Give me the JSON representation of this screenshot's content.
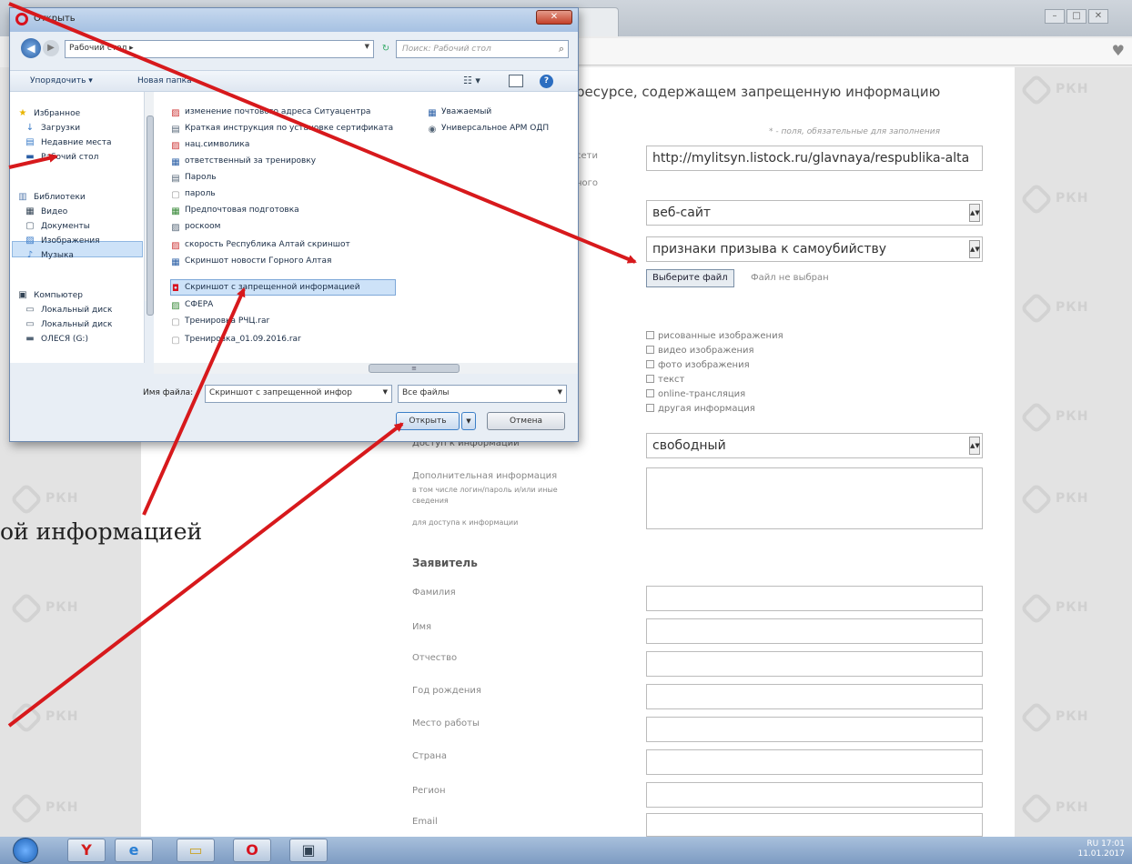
{
  "browser": {
    "window_controls": [
      "–",
      "□",
      "✕"
    ]
  },
  "watermark": {
    "text": "РКН"
  },
  "page": {
    "heading": "ресурсе, содержащем запрещенную информацию",
    "required_note": "* - поля, обязательные для заполнения",
    "label_fragment_1": "сети",
    "label_fragment_2": "ного",
    "url_value": "http://mylitsyn.listock.ru/glavnaya/respublika-alta",
    "resource_type": "веб-сайт",
    "info_type": "признаки призыва к самоубийству",
    "choose_file_label": "Выберите файл",
    "no_file_text": "Файл не выбран",
    "content_types": [
      "рисованные изображения",
      "видео изображения",
      "фото изображения",
      "текст",
      "online-трансляция",
      "другая информация"
    ],
    "access_label": "Доступ к информации",
    "access_value": "свободный",
    "extra_label": "Дополнительная информация",
    "extra_sub1": "в том числе логин/пароль и/или иные",
    "extra_sub2": "сведения",
    "extra_sub3": "для доступа к информации",
    "applicant_section": "Заявитель",
    "applicant_fields": [
      "Фамилия",
      "Имя",
      "Отчество",
      "Год рождения",
      "Место работы",
      "Страна",
      "Регион",
      "Email"
    ]
  },
  "caption": "ой информацией",
  "dialog": {
    "title": "Открыть",
    "path": "Рабочий стол ▸",
    "search_placeholder": "Поиск: Рабочий стол",
    "toolbar_organize": "Упорядочить ▾",
    "toolbar_new_folder": "Новая папка",
    "nav_items": [
      {
        "label": "Избранное",
        "icon": "star-icon"
      },
      {
        "label": "Загрузки",
        "icon": "downloads-icon"
      },
      {
        "label": "Недавние места",
        "icon": "recent-places-icon"
      },
      {
        "label": "Рабочий стол",
        "icon": "desktop-icon"
      },
      {
        "label": "Библиотеки",
        "icon": "libraries-icon"
      },
      {
        "label": "Видео",
        "icon": "video-icon"
      },
      {
        "label": "Документы",
        "icon": "documents-icon"
      },
      {
        "label": "Изображения",
        "icon": "images-icon"
      },
      {
        "label": "Музыка",
        "icon": "music-icon"
      },
      {
        "label": "Компьютер",
        "icon": "computer-icon"
      },
      {
        "label": "Локальный диск",
        "icon": "disk-icon"
      },
      {
        "label": "Локальный диск",
        "icon": "disk-icon"
      },
      {
        "label": "ОЛЕСЯ (G:)",
        "icon": "usb-drive-icon"
      }
    ],
    "files_col1": [
      "изменение почтового адреса Ситуацентра",
      "Краткая инструкция по установке сертификата",
      "нац.символика",
      "ответственный за тренировку",
      "Пароль",
      "пароль",
      "Предпочтовая подготовка",
      "роскоом",
      "скорость Республика Алтай скриншот",
      "Скриншот новости Горного Алтая",
      "Скриншот с запрещенной информацией",
      "СФЕРА",
      "Тренировка РЧЦ.rar",
      "Тренировка_01.09.2016.rar"
    ],
    "files_col2": [
      "Уважаемый",
      "Универсальное АРМ ОДП"
    ],
    "filename_label": "Имя файла:",
    "filename_value": "Скриншот с запрещенной инфор",
    "filetype_value": "Все файлы",
    "open_label": "Открыть",
    "cancel_label": "Отмена"
  },
  "tray": {
    "time": "17:01",
    "date": "11.01.2017",
    "lang": "RU"
  },
  "colors": {
    "arrow": "#d7191c",
    "dialog_border": "#6c89b0",
    "selection": "#cde2f8"
  }
}
